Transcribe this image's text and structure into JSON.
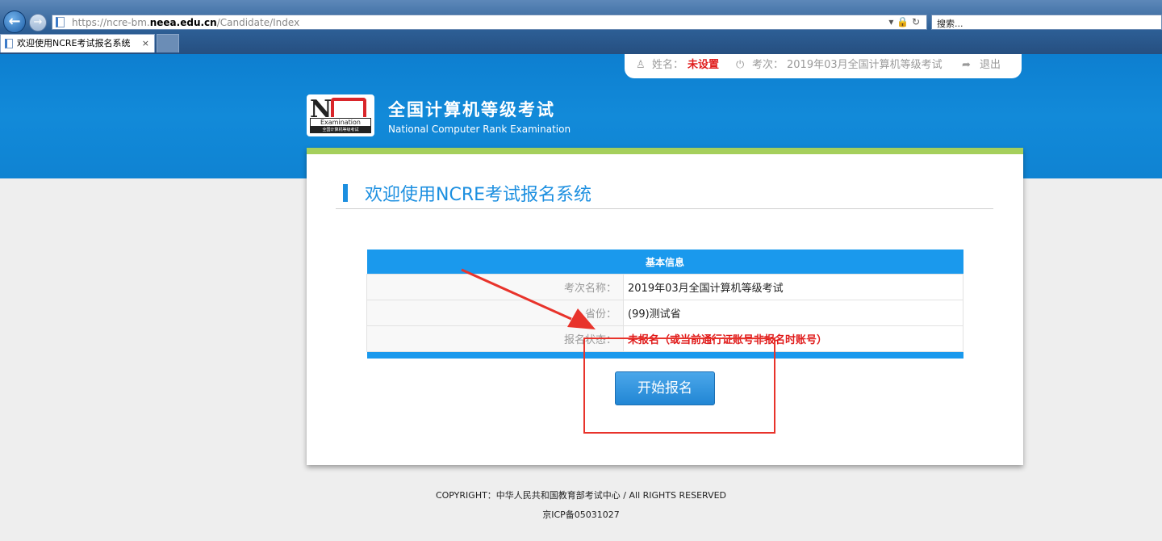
{
  "browser": {
    "url_prefix": "https://ncre-bm.",
    "url_domain": "neea.edu.cn",
    "url_path": "/Candidate/Index",
    "search_placeholder": "搜索...",
    "tab_title": "欢迎使用NCRE考试报名系统",
    "tab_close": "×",
    "back_glyph": "←",
    "forward_glyph": "→",
    "address_icons": "▾ 🔒 ↻"
  },
  "user_bar": {
    "name_label": "姓名：",
    "name_value": "未设置",
    "exam_label": "考次：",
    "exam_value": "2019年03月全国计算机等级考试",
    "logout": "退出",
    "user_icon": "♙",
    "exam_icon": "⏻",
    "logout_icon": "➦"
  },
  "header": {
    "logo_letter": "N",
    "logo_caption": "Examination",
    "logo_subcaption": "全国计算机等级考试",
    "title": "全国计算机等级考试",
    "subtitle": "National Computer Rank Examination"
  },
  "main": {
    "welcome": "欢迎使用NCRE考试报名系统",
    "table_header": "基本信息",
    "rows": [
      {
        "label": "考次名称：",
        "value": "2019年03月全国计算机等级考试"
      },
      {
        "label": "省份：",
        "value": "(99)测试省"
      },
      {
        "label": "报名状态：",
        "value": "未报名（或当前通行证账号非报名时账号）"
      }
    ],
    "start_button": "开始报名"
  },
  "footer": {
    "copyright": "COPYRIGHT：中华人民共和国教育部考试中心 / All RIGHTS RESERVED",
    "icp": "京ICP备05031027"
  },
  "colors": {
    "banner_blue": "#1188d8",
    "accent_blue": "#1c8fe0",
    "stripe_green": "#a5cf5c",
    "alert_red": "#e01b1b",
    "annotation_red": "#e8332b"
  }
}
